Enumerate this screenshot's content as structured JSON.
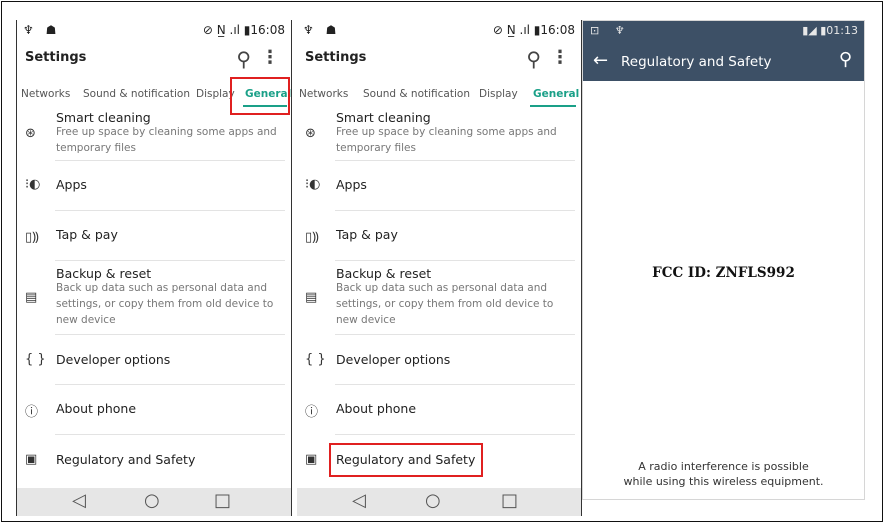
{
  "panel1": {
    "status": {
      "left_icons": "♆ ☗",
      "right_icons": "⊘ N̲ .ıl ▮",
      "time": "16:08"
    },
    "title": "Settings",
    "tabs": [
      "Networks",
      "Sound & notification",
      "Display",
      "General"
    ],
    "items": [
      {
        "title": "Smart cleaning",
        "desc": "Free up space by cleaning some apps and temporary files",
        "icon": "smart-cleaning-icon"
      },
      {
        "title": "Apps",
        "desc": "",
        "icon": "apps-icon"
      },
      {
        "title": "Tap & pay",
        "desc": "",
        "icon": "tap-pay-icon"
      },
      {
        "title": "Backup & reset",
        "desc": "Back up data such as personal data and settings, or copy them from old device to new device",
        "icon": "backup-icon"
      },
      {
        "title": "Developer options",
        "desc": "",
        "icon": "developer-icon"
      },
      {
        "title": "About phone",
        "desc": "",
        "icon": "info-icon"
      },
      {
        "title": "Regulatory and Safety",
        "desc": "",
        "icon": "regulatory-icon"
      }
    ]
  },
  "panel2": {
    "status": {
      "left_icons": "♆ ☗",
      "right_icons": "⊘ N̲ .ıl ▮",
      "time": "16:08"
    },
    "title": "Settings",
    "tabs": [
      "Networks",
      "Sound & notification",
      "Display",
      "General"
    ],
    "items": [
      {
        "title": "Smart cleaning",
        "desc": "Free up space by cleaning some apps and temporary files"
      },
      {
        "title": "Apps",
        "desc": ""
      },
      {
        "title": "Tap & pay",
        "desc": ""
      },
      {
        "title": "Backup & reset",
        "desc": "Back up data such as personal data and settings, or copy them from old device to new device"
      },
      {
        "title": "Developer options",
        "desc": ""
      },
      {
        "title": "About phone",
        "desc": ""
      },
      {
        "title": "Regulatory and Safety",
        "desc": ""
      }
    ]
  },
  "panel3": {
    "status": {
      "left_icons": "⊡ ♆",
      "right_icons": "▮◢ ▮",
      "time": "01:13"
    },
    "title": "Regulatory and Safety",
    "fcc": "FCC ID: ZNFLS992",
    "radio_line1": "A radio interference is possible",
    "radio_line2": "while using this wireless equipment."
  },
  "colors": {
    "accent": "#1aa088",
    "highlight": "#e02020",
    "appbar_dark": "#3d5066"
  }
}
